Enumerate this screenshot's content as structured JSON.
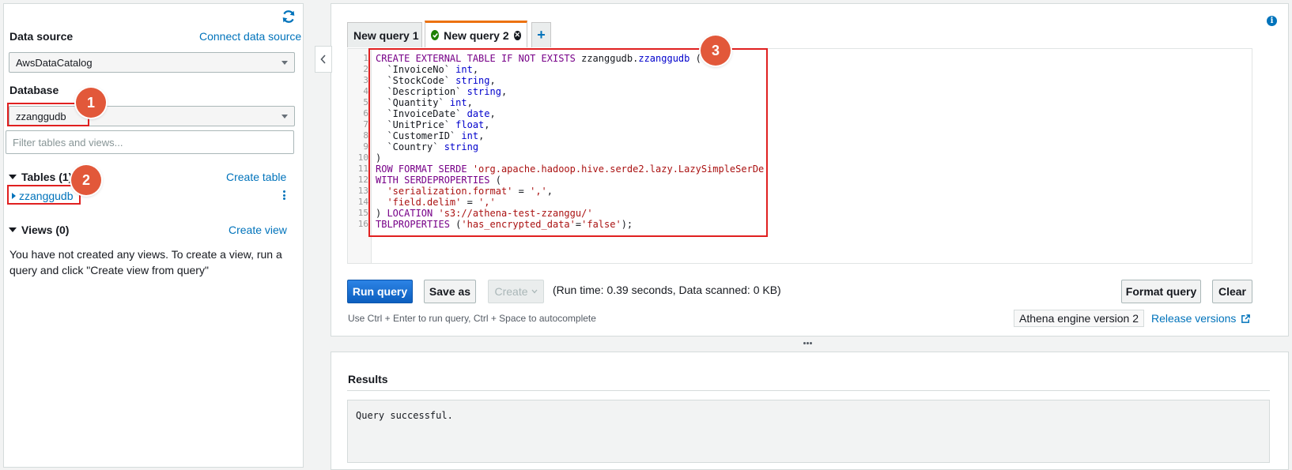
{
  "sidebar": {
    "data_source_label": "Data source",
    "connect_link": "Connect data source",
    "data_source_value": "AwsDataCatalog",
    "database_label": "Database",
    "database_value": "zzanggudb",
    "filter_placeholder": "Filter tables and views...",
    "tables_header": "Tables (1)",
    "create_table_link": "Create table",
    "table_item": "zzanggudb",
    "views_header": "Views (0)",
    "create_view_link": "Create view",
    "views_empty": "You have not created any views. To create a view, run a query and click \"Create view from query\""
  },
  "annotations": {
    "badge1": "1",
    "badge2": "2",
    "badge3": "3",
    "highlight_color": "#e02020",
    "badge_color": "#e2583a"
  },
  "tabs": {
    "tab1": "New query 1",
    "tab2": "New query 2",
    "add": "+"
  },
  "editor": {
    "line_numbers": [
      "1",
      "2",
      "3",
      "4",
      "5",
      "6",
      "7",
      "8",
      "9",
      "10",
      "11",
      "12",
      "13",
      "14",
      "15",
      "16"
    ]
  },
  "toolbar": {
    "run_query": "Run query",
    "save_as": "Save as",
    "create": "Create",
    "runtime": "(Run time: 0.39 seconds, Data scanned: 0 KB)",
    "format_query": "Format query",
    "clear": "Clear",
    "hint": "Use Ctrl + Enter to run query, Ctrl + Space to autocomplete",
    "engine": "Athena engine version 2",
    "release_versions": "Release versions"
  },
  "results": {
    "title": "Results",
    "message": "Query successful."
  },
  "colors": {
    "link": "#0073bb",
    "primary_button": "#0c5fbf",
    "active_tab_accent": "#ec7211",
    "success": "#1d8102"
  }
}
